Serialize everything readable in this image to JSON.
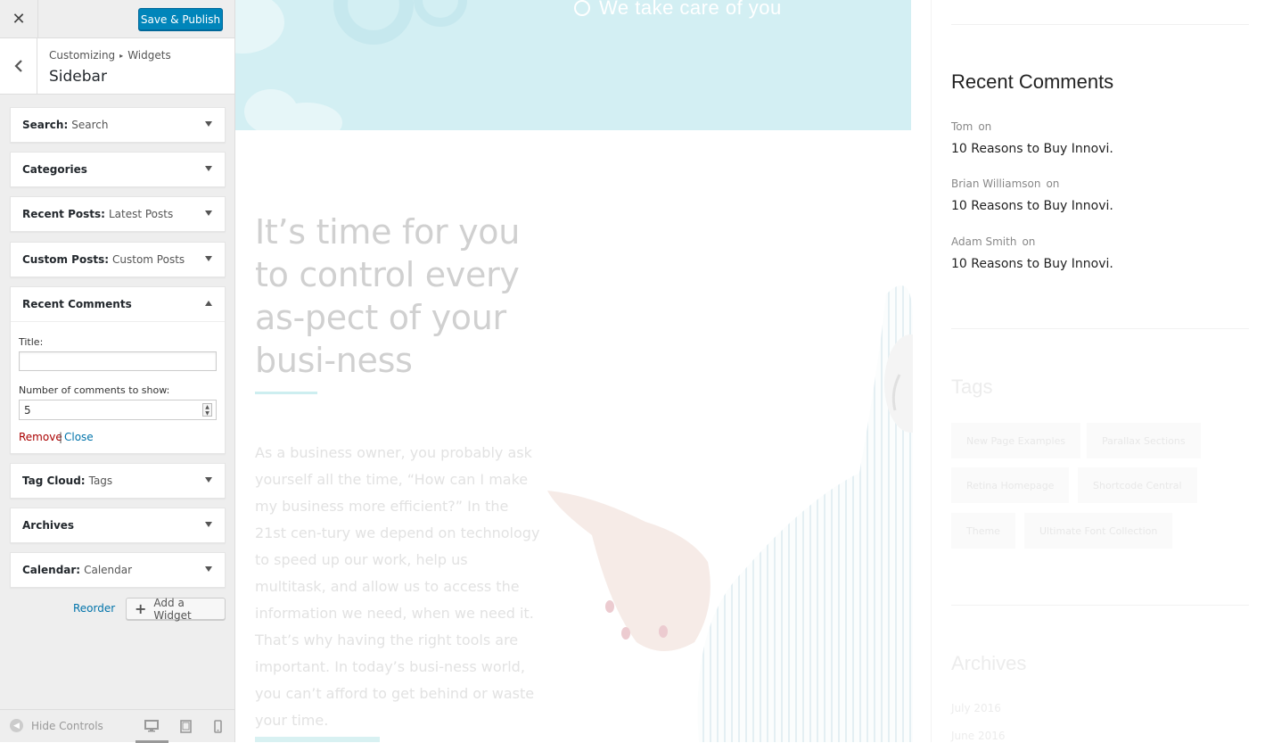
{
  "header": {
    "close_symbol": "✕",
    "save_label": "Save & Publish"
  },
  "breadcrumb": {
    "path_root": "Customizing",
    "path_separator": "▸",
    "path_section": "Widgets",
    "title": "Sidebar"
  },
  "widgets": [
    {
      "name": "Search:",
      "sub": "Search"
    },
    {
      "name": "Categories",
      "sub": ""
    },
    {
      "name": "Recent Posts:",
      "sub": "Latest Posts"
    },
    {
      "name": "Custom Posts:",
      "sub": "Custom Posts"
    },
    {
      "name": "Recent Comments",
      "sub": ""
    },
    {
      "name": "Tag Cloud:",
      "sub": "Tags"
    },
    {
      "name": "Archives",
      "sub": ""
    },
    {
      "name": "Calendar:",
      "sub": "Calendar"
    }
  ],
  "recent_comments_form": {
    "title_label": "Title:",
    "title_value": "",
    "count_label": "Number of comments to show:",
    "count_value": "5",
    "remove_label": "Remove",
    "pipe": "|",
    "close_label": "Close"
  },
  "actions": {
    "reorder_label": "Reorder",
    "add_plus": "+",
    "add_widget_label": "Add a Widget"
  },
  "footer": {
    "hide_controls_label": "Hide Controls",
    "hide_controls_symbol": "◀"
  },
  "preview": {
    "hero_text": "We take care of you",
    "headline": "It’s time for you to control every as-pect of your busi-ness",
    "paragraph": "As a business owner, you probably ask yourself all the time, “How can I make my business more efficient?” In the 21st cen-tury we depend on technology to speed up our work, help us multitask, and allow us to access the information we need, when we need it. That’s why having the right tools are important. In today’s busi-ness world, you can’t afford to get behind or waste your time.",
    "sidebar": {
      "recent_comments_title": "Recent Comments",
      "comments": [
        {
          "author": "Tom",
          "on": "on",
          "post": "10 Reasons to Buy Innovi."
        },
        {
          "author": "Brian Williamson",
          "on": "on",
          "post": "10 Reasons to Buy Innovi."
        },
        {
          "author": "Adam Smith",
          "on": "on",
          "post": "10 Reasons to Buy Innovi."
        }
      ],
      "tags_title": "Tags",
      "tags": [
        "New Page Examples",
        "Parallax Sections",
        "Retina Homepage",
        "Shortcode Central",
        "Theme",
        "Ultimate Font Collection"
      ],
      "archives_title": "Archives",
      "archives": [
        "July 2016",
        "June 2016"
      ]
    }
  },
  "colors": {
    "primary": "#0085ba",
    "link": "#0073aa",
    "remove": "#aa0000",
    "hero_bg": "#d3eff3"
  }
}
